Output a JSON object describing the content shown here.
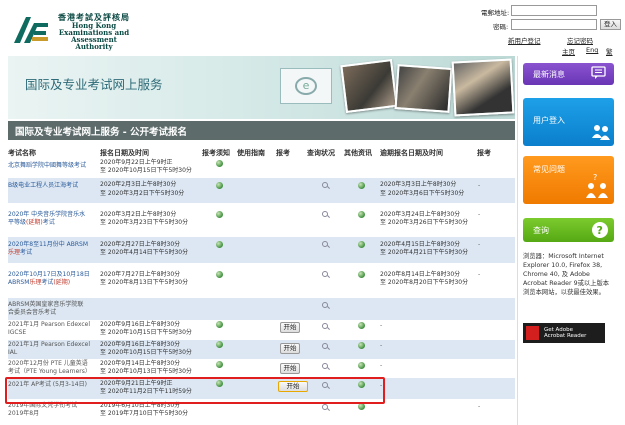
{
  "header": {
    "logo_cn": "香港考試及評核局",
    "logo_en": [
      "Hong Kong",
      "Examinations and",
      "Assessment Authority"
    ]
  },
  "login": {
    "email_label": "電郵地址:",
    "password_label": "密碼:",
    "login_button": "登入",
    "links": [
      "新用户登记",
      "忘记密码"
    ],
    "sub_links": [
      "主页",
      "Eng",
      "繁"
    ]
  },
  "banner": {
    "title": "国际及专业考试网上服务",
    "section_title": "国际及专业考试网上服务 - 公开考试报名"
  },
  "table": {
    "headers": [
      "考试名称",
      "报名日期及时间",
      "报考须知",
      "使用指南",
      "报考",
      "查询状况",
      "其他资讯",
      "逾期报名日期及时间",
      "报考"
    ],
    "rows": [
      {
        "name": [
          "北京舞蹈学院中國舞等级考试"
        ],
        "date": [
          "2020年9月22日上午9时正",
          "至 2020年10月15日下午5时30分"
        ],
        "late": [],
        "start": "",
        "late_flag": ""
      },
      {
        "name": [
          "B级电业工程人员江海考试"
        ],
        "date": [
          "2020年2月3日上午8时30分",
          "至 2020年3月2日下午5时30分"
        ],
        "late": [
          "2020年3月3日上午8时30分",
          "至 2020年3月6日下午5时30分"
        ],
        "start": "",
        "late_flag": "-"
      },
      {
        "name": [
          "2020年 中央音乐学院音乐水",
          "平等级",
          "考试"
        ],
        "name_red": "(延期)",
        "date": [
          "2020年3月2日上午8时30分",
          "至 2020年3月23日下午5时30分"
        ],
        "late": [
          "2020年3月24日上午8时30分",
          "至 2020年3月26日下午5时30分"
        ],
        "start": "",
        "late_flag": "-"
      },
      {
        "name": [
          "2020年8至11月份中 ABRSM",
          "",
          "考试"
        ],
        "name_red": "乐理",
        "date": [
          "2020年2月27日上午8时30分",
          "至 2020年4月14日下午5时30分"
        ],
        "late": [
          "2020年4月15日上午8时30分",
          "至 2020年4月21日下午5时30分"
        ],
        "start": "",
        "late_flag": "-"
      },
      {
        "name": [
          "2020年10月17日及10月18日",
          "ABRSM",
          "考试",
          ""
        ],
        "name_red": "乐理",
        "name_red2": "(延期)",
        "date": [
          "2020年7月27日上午8时30分",
          "至 2020年8月13日下午5时30分"
        ],
        "late": [
          "2020年8月14日上午8时30分",
          "至 2020年8月20日下午5时30分"
        ],
        "start": "",
        "late_flag": "-"
      },
      {
        "name": [
          "ABRSM英国皇家音乐学院联",
          "合委员会音乐考试"
        ],
        "date": [],
        "late": [],
        "start": "",
        "late_flag": ""
      },
      {
        "name": [
          "2021年1月 Pearson Edexcel",
          "IGCSE"
        ],
        "date": [
          "2020年9月16日上午8时30分",
          "至 2020年10月15日下午5时30分"
        ],
        "late": [],
        "start": "开始",
        "late_flag": "-"
      },
      {
        "name": [
          "2021年1月 Pearson Edexcel",
          "IAL"
        ],
        "date": [
          "2020年9月16日上午8时30分",
          "至 2020年10月15日下午5时30分"
        ],
        "late": [],
        "start": "开始",
        "late_flag": "-"
      },
      {
        "name": [
          "2020年12月份 PTE 儿童英语",
          "考试（PTE Young Learners）"
        ],
        "date": [
          "2020年9月14日上午8时30分",
          "至 2020年10月13日下午5时30分"
        ],
        "late": [],
        "start": "开始",
        "late_flag": "-"
      },
      {
        "name": [
          "2021年 AP考试 (5月3-14日)"
        ],
        "date": [
          "2020年9月21日上午9时正",
          "至 2020年11月2日下午11时59分"
        ],
        "late": [],
        "start": "开始",
        "late_flag": "-"
      },
      {
        "name": [
          "2019年国际文凭学衔考试",
          "2019年8月"
        ],
        "date": [
          "2019年6月10日上午8时30分",
          "至 2019年7月10日下午5时30分"
        ],
        "late": [],
        "start": "",
        "late_flag": "-"
      }
    ]
  },
  "sidebar": {
    "news": "最新消息",
    "user_login": "用户登入",
    "faq": "常见问题",
    "enquiry": "查询",
    "note": "浏览器：Microsoft Internet Explorer 10.0, Firefox 38, Chrome 40, 及 Adobe Acrobat Reader 9或以上版本浏览本网站，以获最佳效果。",
    "adobe": [
      "Get Adobe",
      "Acrobat Reader"
    ]
  },
  "colors": {
    "news": "#7a45c4",
    "user": "#1190dc",
    "faq": "#f58a0c",
    "enquiry": "#6abb22",
    "highlight": "#e01e1e"
  }
}
